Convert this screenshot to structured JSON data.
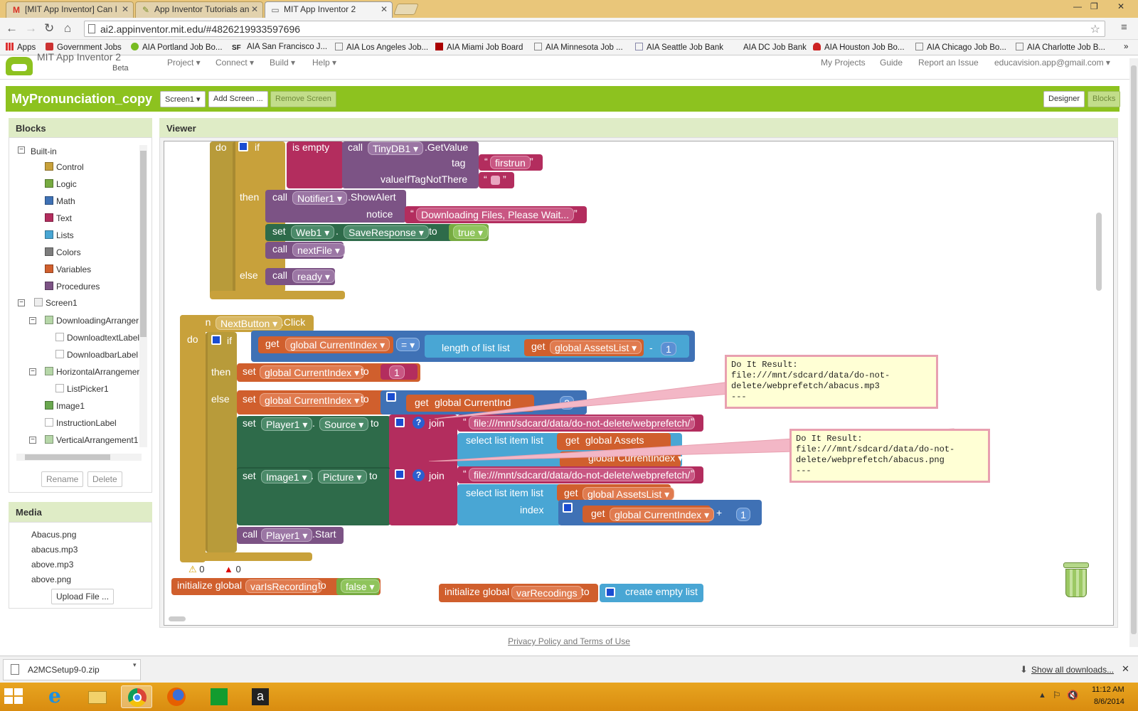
{
  "browser": {
    "tabs": [
      {
        "title": "[MIT App Inventor] Can I"
      },
      {
        "title": "App Inventor Tutorials an"
      },
      {
        "title": "MIT App Inventor 2"
      }
    ],
    "url": "ai2.appinventor.mit.edu/#4826219933597696",
    "bookmarks": [
      {
        "label": "Apps"
      },
      {
        "label": "Government Jobs"
      },
      {
        "label": "AIA Portland Job Bo..."
      },
      {
        "label": "AIA San Francisco J..."
      },
      {
        "label": "AIA Los Angeles Job..."
      },
      {
        "label": "AIA Miami Job Board"
      },
      {
        "label": "AIA Minnesota Job ..."
      },
      {
        "label": "AIA Seattle Job Bank"
      },
      {
        "label": "AIA DC Job Bank"
      },
      {
        "label": "AIA Houston Job Bo..."
      },
      {
        "label": "AIA Chicago Job Bo..."
      },
      {
        "label": "AIA Charlotte Job B..."
      }
    ],
    "bookmarks_more": "»"
  },
  "app": {
    "logo_title": "MIT App Inventor 2",
    "logo_sub": "Beta",
    "menus": [
      "Project ▾",
      "Connect ▾",
      "Build ▾",
      "Help ▾"
    ],
    "right_links": [
      "My Projects",
      "Guide",
      "Report an Issue",
      "educavision.app@gmail.com ▾"
    ],
    "project_name": "MyPronunciation_copy",
    "screen_btn": "Screen1 ▾",
    "add_screen": "Add Screen ...",
    "remove_screen": "Remove Screen",
    "designer": "Designer",
    "blocks": "Blocks"
  },
  "blocks_panel": {
    "title": "Blocks",
    "builtin_label": "Built-in",
    "builtin": [
      {
        "label": "Control",
        "color": "#c8a13b"
      },
      {
        "label": "Logic",
        "color": "#77ab41"
      },
      {
        "label": "Math",
        "color": "#3f71b5"
      },
      {
        "label": "Text",
        "color": "#b32d5e"
      },
      {
        "label": "Lists",
        "color": "#49a6d4"
      },
      {
        "label": "Colors",
        "color": "#7d7d7d"
      },
      {
        "label": "Variables",
        "color": "#d05f2d"
      },
      {
        "label": "Procedures",
        "color": "#7c5385"
      }
    ],
    "screen_label": "Screen1",
    "components": [
      {
        "label": "DownloadingArranger"
      },
      {
        "label": "DownloadtextLabel"
      },
      {
        "label": "DownloadbarLabel"
      },
      {
        "label": "HorizontalArrangemer"
      },
      {
        "label": "ListPicker1"
      },
      {
        "label": "Image1"
      },
      {
        "label": "InstructionLabel"
      },
      {
        "label": "VerticalArrangement1"
      }
    ],
    "rename": "Rename",
    "delete": "Delete"
  },
  "media_panel": {
    "title": "Media",
    "files": [
      "Abacus.png",
      "abacus.mp3",
      "above.mp3",
      "above.png"
    ],
    "upload": "Upload File ..."
  },
  "viewer": {
    "title": "Viewer",
    "warnings": "0",
    "errors": "0"
  },
  "code": {
    "do": "do",
    "if": "if",
    "is_empty": "is empty",
    "call": "call",
    "tinydb": "TinyDB1 ▾",
    "getvalue": ".GetValue",
    "tag": "tag",
    "firstrun": "firstrun",
    "value_if_tag": "valueIfTagNotThere",
    "then": "then",
    "notifier": "Notifier1 ▾",
    "showalert": ".ShowAlert",
    "notice": "notice",
    "downloading": "Downloading Files, Please Wait...",
    "set": "set",
    "web1": "Web1 ▾",
    "dot": ".",
    "saveresponse": "SaveResponse ▾",
    "to": "to",
    "true_val": "true ▾",
    "nextfile": "nextFile ▾",
    "else": "else",
    "ready": "ready ▾",
    "when": "when",
    "nextbutton": "NextButton ▾",
    "click": ".Click",
    "get": "get",
    "global_currentindex": "global CurrentIndex ▾",
    "eq": "= ▾",
    "length_of_list": "length of list  list",
    "global_assetslist": "global AssetsList ▾",
    "minus": "-",
    "one": "1",
    "set_global_currentindex": "global CurrentIndex ▾",
    "two": "2",
    "player1": "Player1 ▾",
    "source": "Source ▾",
    "join": "join",
    "file_path": "file:///mnt/sdcard/data/do-not-delete/webprefetch/",
    "select_list_item": "select list item   list",
    "index": "index",
    "global_assets_cut": "global Assets",
    "global_currentind_cut": "global CurrentInd",
    "image1": "Image1 ▾",
    "picture": "Picture ▾",
    "plus": "+",
    "player1_call": "Player1 ▾",
    "start": ".Start",
    "init_global": "initialize global",
    "varisrecording": "varIsRecording",
    "false_val": "false ▾",
    "varrecodings": "varRecodings",
    "create_empty_list": "create empty list"
  },
  "results": [
    {
      "text": "Do It Result:\nfile:///mnt/sdcard/data/do-not-\ndelete/webprefetch/abacus.mp3\n---"
    },
    {
      "text": "Do It Result:\nfile:///mnt/sdcard/data/do-not-\ndelete/webprefetch/abacus.png\n---"
    }
  ],
  "footer": "Privacy Policy and Terms of Use",
  "download": {
    "file": "A2MCSetup9-0.zip",
    "show_all": "Show all downloads..."
  },
  "clock": {
    "time": "11:12 AM",
    "date": "8/6/2014"
  }
}
